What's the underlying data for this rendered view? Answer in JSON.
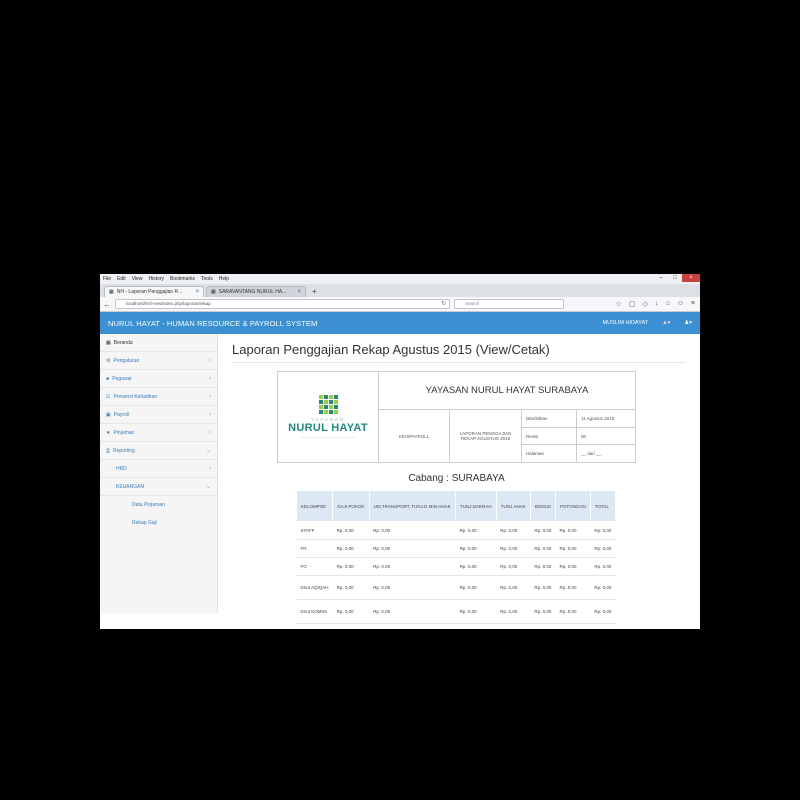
{
  "browser": {
    "menu": [
      "File",
      "Edit",
      "View",
      "History",
      "Bookmarks",
      "Tools",
      "Help"
    ],
    "tabs": [
      {
        "label": "NH - Laporan Penggajian R..."
      },
      {
        "label": "SARAVANTANG NURUL HA..."
      }
    ],
    "url": "localhost/hrd-new/index.php/laporan/rekap",
    "search_placeholder": "Search"
  },
  "app": {
    "title": "NURUL HAYAT - HUMAN RESOURCE & PAYROLL SYSTEM",
    "user": "MUSLIM HIDAYAT"
  },
  "sidebar": {
    "items": [
      {
        "label": "Beranda",
        "icon": "dashboard-icon"
      },
      {
        "label": "Pengaturan",
        "icon": "settings-icon"
      },
      {
        "label": "Pegawai",
        "icon": "users-icon"
      },
      {
        "label": "Presensi Kehadiran",
        "icon": "checklist-icon"
      },
      {
        "label": "Payroll",
        "icon": "money-icon"
      },
      {
        "label": "Pinjaman",
        "icon": "star-icon"
      },
      {
        "label": "Reporting",
        "icon": "print-icon"
      }
    ],
    "sub": [
      "HRD",
      "KEUANGAN"
    ],
    "subsub": [
      "Data Pinjaman",
      "Rekap Gaji"
    ]
  },
  "main": {
    "page_title": "Laporan Penggajian Rekap Agustus 2015 (View/Cetak)"
  },
  "report": {
    "logo_top": "YAYASAN",
    "logo_name": "NURUL HAYAT",
    "org": "YAYASAN NURUL HAYAT SURABAYA",
    "dept": "KEU/PAYROLL",
    "doc_title": "LAPORAN PENGGAJIAN REKAP AGUSTUS 2015",
    "fields": [
      {
        "k": "Diterbitkan",
        "v": "11 Agustus 2015"
      },
      {
        "k": "Revisi",
        "v": "00"
      },
      {
        "k": "Halaman",
        "v": "__ dari __"
      }
    ],
    "branch": "Cabang : SURABAYA",
    "columns": [
      "KELOMPOK",
      "GAJI POKOK",
      "UM,TRANSPORT, TUNJ.D MIN-ANAK",
      "TUNJ.DAERAH",
      "TUNJ.ANAK",
      "BONUS",
      "POTONGAN",
      "TOTAL"
    ],
    "rows": [
      {
        "kelompok": "STAFF",
        "tall": false,
        "vals": [
          "Rp. 0,00",
          "Rp. 0,00",
          "Rp. 0,00",
          "Rp. 0,00",
          "Rp. 0,00",
          "Rp. 0,00",
          "Rp. 0,00"
        ]
      },
      {
        "kelompok": "FR",
        "tall": false,
        "vals": [
          "Rp. 0,00",
          "Rp. 0,00",
          "Rp. 0,00",
          "Rp. 0,00",
          "Rp. 0,00",
          "Rp. 0,00",
          "Rp. 0,00"
        ]
      },
      {
        "kelompok": "FO",
        "tall": false,
        "vals": [
          "Rp. 0,00",
          "Rp. 0,00",
          "Rp. 0,00",
          "Rp. 0,00",
          "Rp. 0,00",
          "Rp. 0,00",
          "Rp. 0,00"
        ]
      },
      {
        "kelompok": "Dirut AQIQAH",
        "tall": true,
        "vals": [
          "Rp. 0,00",
          "Rp. 0,00",
          "Rp. 0,00",
          "Rp. 0,00",
          "Rp. 0,00",
          "Rp. 0,00",
          "Rp. 0,00"
        ]
      },
      {
        "kelompok": "Dirut KOMISI",
        "tall": true,
        "vals": [
          "Rp. 0,00",
          "Rp. 0,00",
          "Rp. 0,00",
          "Rp. 0,00",
          "Rp. 0,00",
          "Rp. 0,00",
          "Rp. 0,00"
        ]
      }
    ]
  },
  "colors": {
    "header": "#3b8fd3",
    "link": "#3a7bbf",
    "logo": "#1d8c7a",
    "table_head": "#dce9f5"
  }
}
